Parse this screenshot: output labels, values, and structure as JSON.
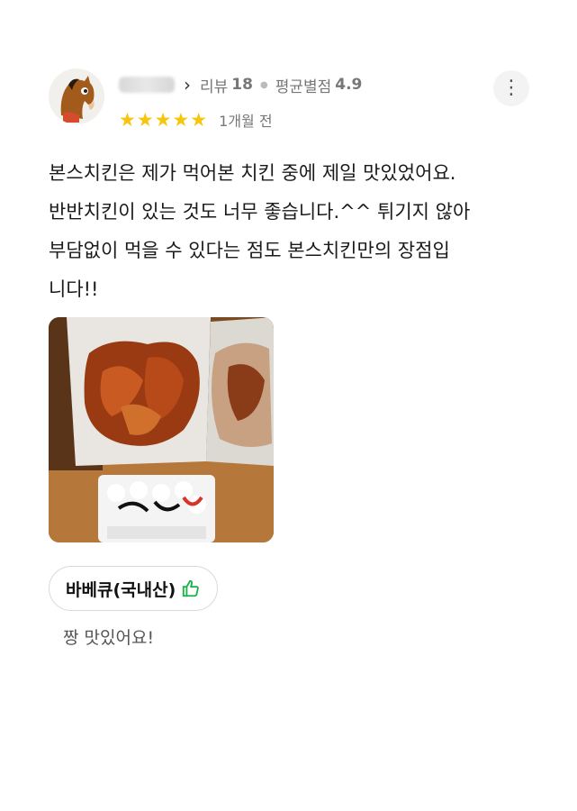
{
  "reviewer": {
    "review_label": "리뷰",
    "review_count": "18",
    "avg_label": "평균별점",
    "avg_rating": "4.9",
    "stars": "★★★★★",
    "time_ago": "1개월 전",
    "chevron": "›",
    "more": "⋮"
  },
  "review": {
    "text": "본스치킨은 제가 먹어본 치킨 중에 제일 맛있었어요.\n 반반치킨이 있는 것도 너무 좋습니다.^^ 튀기지 않아\n 부담없이 먹을 수 있다는 점도 본스치킨만의 장점입\n니다!!"
  },
  "menu_tag": {
    "label": "바베큐(국내산)"
  },
  "menu_comment": "짱 맛있어요!"
}
